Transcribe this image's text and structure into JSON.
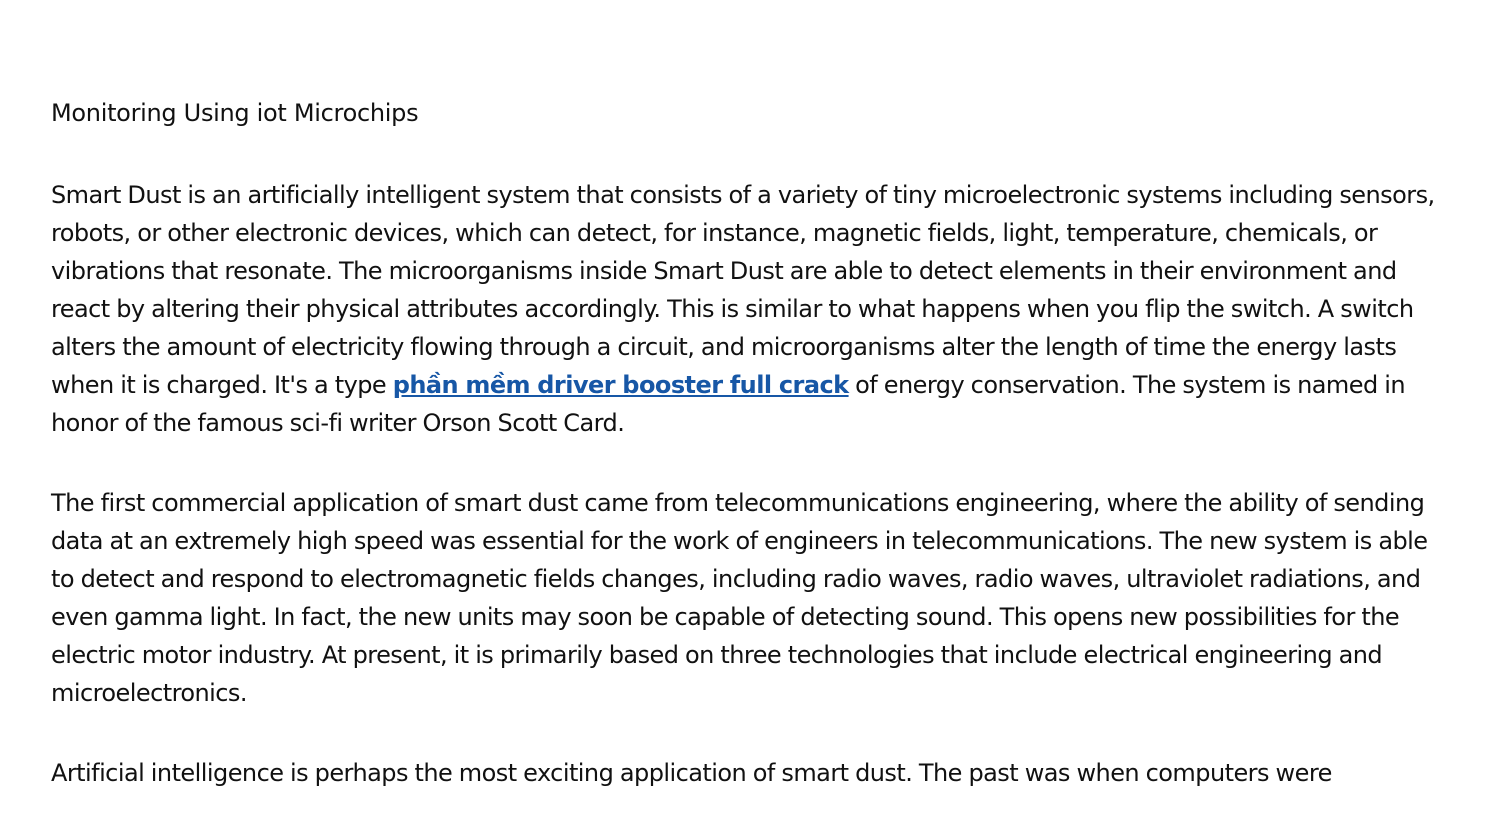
{
  "document": {
    "title": "Monitoring Using iot Microchips",
    "paragraphs": [
      {
        "before": "Smart Dust is an artificially intelligent system that consists of a variety of tiny microelectronic systems including sensors, robots, or other electronic devices, which can detect, for instance, magnetic fields, light, temperature, chemicals, or vibrations that resonate. The microorganisms inside Smart Dust are able to detect elements in their environment and react by altering their physical attributes accordingly. This is similar to what happens when you flip the switch. A switch alters the amount of electricity flowing through a circuit, and microorganisms alter the length of time the energy lasts when it is charged. It's a type ",
        "link": "phần mềm driver booster full crack",
        "after": " of energy conservation. The system is named in honor of the famous sci-fi writer Orson Scott Card."
      },
      {
        "text": "The first commercial application of smart dust came from telecommunications engineering, where the ability of sending data at an extremely high speed was essential for the work of engineers in telecommunications. The new system is able to detect and respond to electromagnetic fields changes, including radio waves, radio waves, ultraviolet radiations, and even gamma light. In fact, the new units may soon be capable of detecting sound. This opens new possibilities for the electric motor industry. At present, it is primarily based on three technologies that include electrical engineering and microelectronics."
      },
      {
        "text": "Artificial intelligence is perhaps the most exciting application of smart dust. The past was when computers were"
      }
    ]
  },
  "colors": {
    "text": "#111111",
    "link": "#1757a6",
    "background": "#ffffff"
  }
}
